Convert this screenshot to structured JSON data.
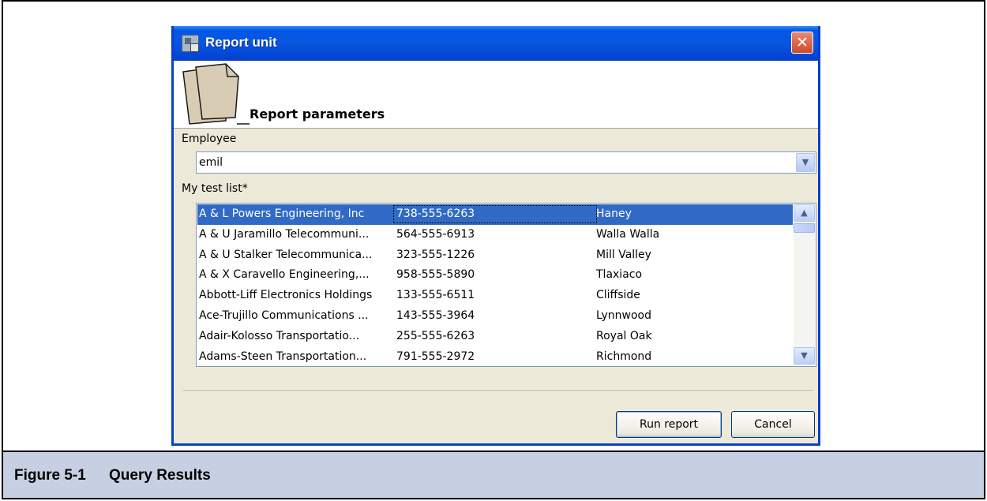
{
  "window": {
    "title": "Report unit",
    "close_glyph": "✕",
    "header_title": "Report parameters"
  },
  "employee": {
    "label": "Employee",
    "value": "emil",
    "arrow_glyph": "▼"
  },
  "list": {
    "label": "My test list*",
    "rows": [
      {
        "company": "A & L Powers Engineering, Inc",
        "phone": "738-555-6263",
        "city": "Haney",
        "selected": true
      },
      {
        "company": "A & U Jaramillo Telecommuni...",
        "phone": "564-555-6913",
        "city": "Walla Walla"
      },
      {
        "company": "A & U Stalker Telecommunica...",
        "phone": "323-555-1226",
        "city": "Mill Valley"
      },
      {
        "company": "A & X Caravello Engineering,...",
        "phone": "958-555-5890",
        "city": "Tlaxiaco"
      },
      {
        "company": "Abbott-Liff Electronics Holdings",
        "phone": "133-555-6511",
        "city": "Cliffside"
      },
      {
        "company": "Ace-Trujillo Communications ...",
        "phone": "143-555-3964",
        "city": "Lynnwood"
      },
      {
        "company": "Adair-Kolosso Transportatio...",
        "phone": "255-555-6263",
        "city": "Royal Oak"
      },
      {
        "company": "Adams-Steen Transportation...",
        "phone": "791-555-2972",
        "city": "Richmond"
      }
    ],
    "scroll_up_glyph": "▲",
    "scroll_down_glyph": "▼"
  },
  "buttons": {
    "run": "Run report",
    "cancel": "Cancel"
  },
  "caption": {
    "number": "Figure 5-1",
    "title": "Query Results"
  },
  "colors": {
    "selection": "#316ac5",
    "titlebar": "#0058e6",
    "caption_bar": "#c6d0e2"
  }
}
